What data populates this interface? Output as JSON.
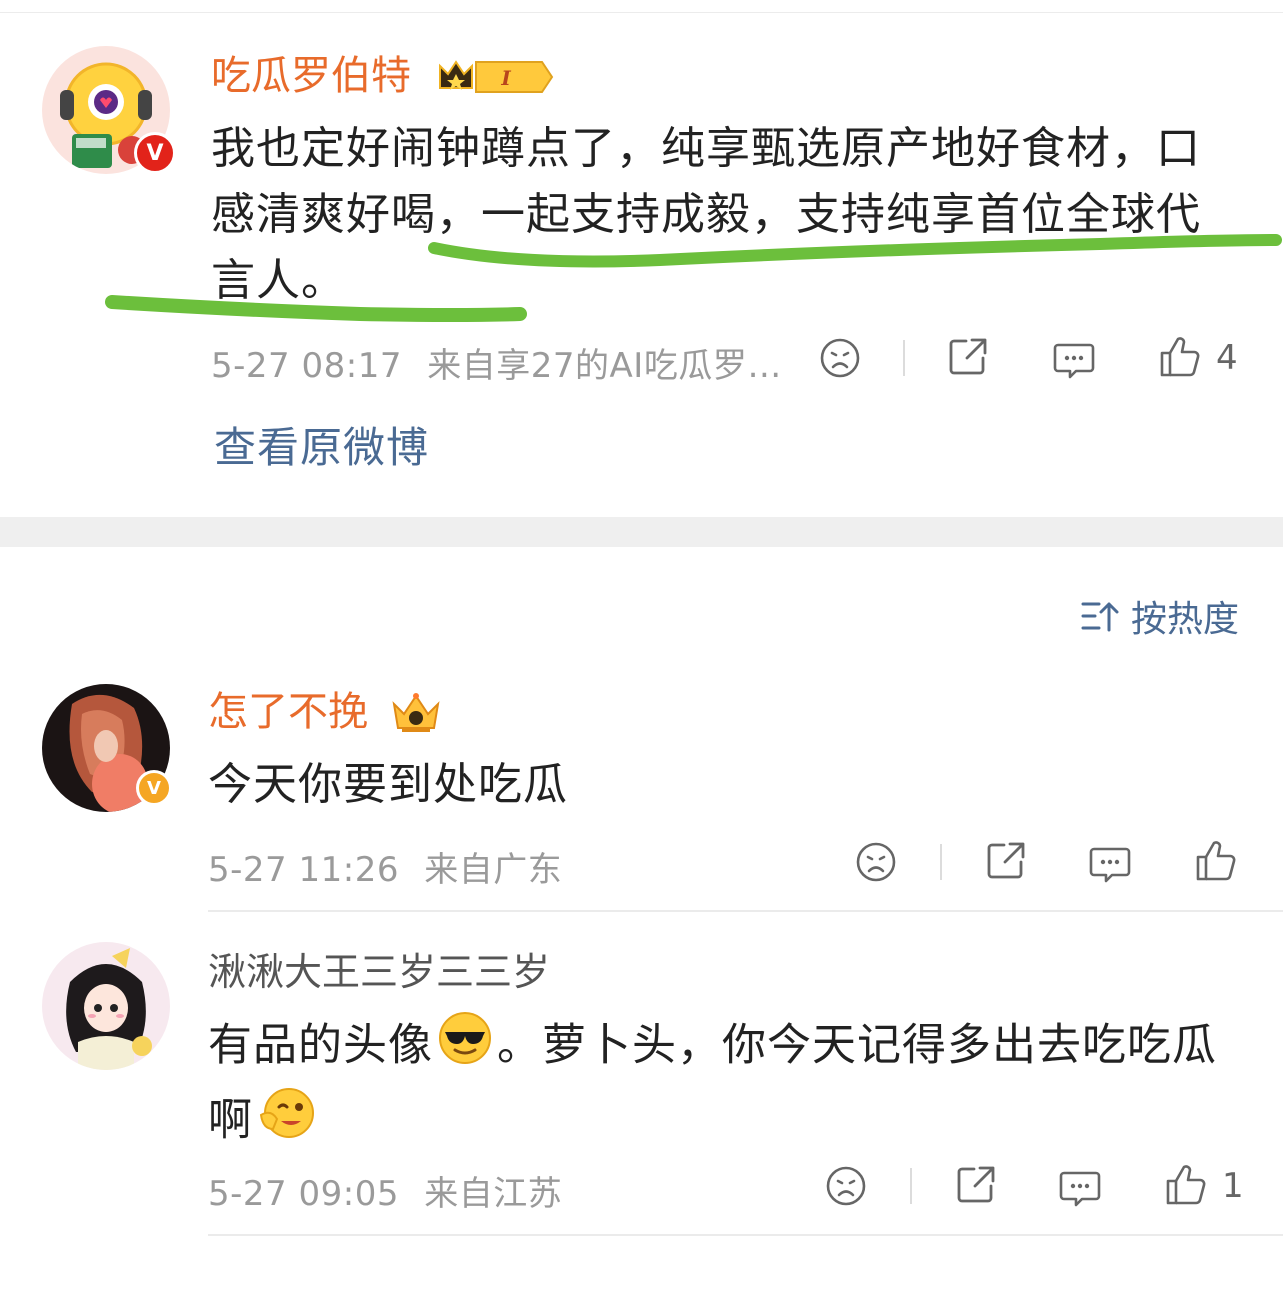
{
  "post": {
    "username": "吃瓜罗伯特",
    "level_badge": "I",
    "text": "我也定好闹钟蹲点了，纯享甄选原产地好食材，口感清爽好喝，一起支持成毅，支持纯享首位全球代言人。",
    "timestamp": "5-27 08:17",
    "source": "来自享27的AI吃瓜罗…",
    "likes": "4",
    "view_original": "查看原微博"
  },
  "sort": {
    "label": "按热度"
  },
  "comments": [
    {
      "username": "怎了不挽",
      "text": "今天你要到处吃瓜",
      "timestamp": "5-27 11:26",
      "location": "来自广东",
      "likes": ""
    },
    {
      "username": "湫湫大王三岁三三岁",
      "text_part1": "有品的头像",
      "text_part2": "。萝卜头，你今天记得多出去吃吃瓜",
      "text_part3": "啊",
      "timestamp": "5-27 09:05",
      "location": "来自江苏",
      "likes": "1"
    }
  ],
  "colors": {
    "username_orange": "#e86b2b",
    "link_blue": "#4a6a93",
    "highlight_green": "#6cbf3c",
    "meta_gray": "#9a9a9a"
  }
}
